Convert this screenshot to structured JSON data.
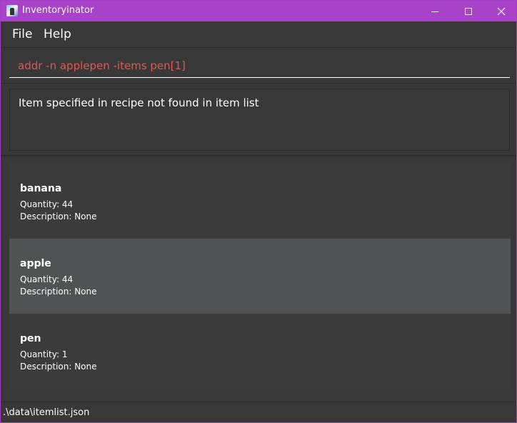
{
  "window": {
    "title": "Inventoryinator",
    "title_bar_color": "#a843c7",
    "icons": {
      "app": "app-icon",
      "minimize": "minimize-icon",
      "maximize": "maximize-icon",
      "close": "close-icon"
    }
  },
  "menu": {
    "file_label": "File",
    "help_label": "Help"
  },
  "command": {
    "value": "addr -n applepen -items pen[1]",
    "text_color": "#e0594b"
  },
  "result": {
    "message": "Item specified in recipe not found in item list"
  },
  "items": [
    {
      "name": "banana",
      "quantity": "Quantity: 44",
      "description": "Description: None",
      "selected": false
    },
    {
      "name": "apple",
      "quantity": "Quantity: 44",
      "description": "Description: None",
      "selected": true
    },
    {
      "name": "pen",
      "quantity": "Quantity: 1",
      "description": "Description: None",
      "selected": false
    }
  ],
  "status": {
    "path": ".\\data\\itemlist.json"
  }
}
